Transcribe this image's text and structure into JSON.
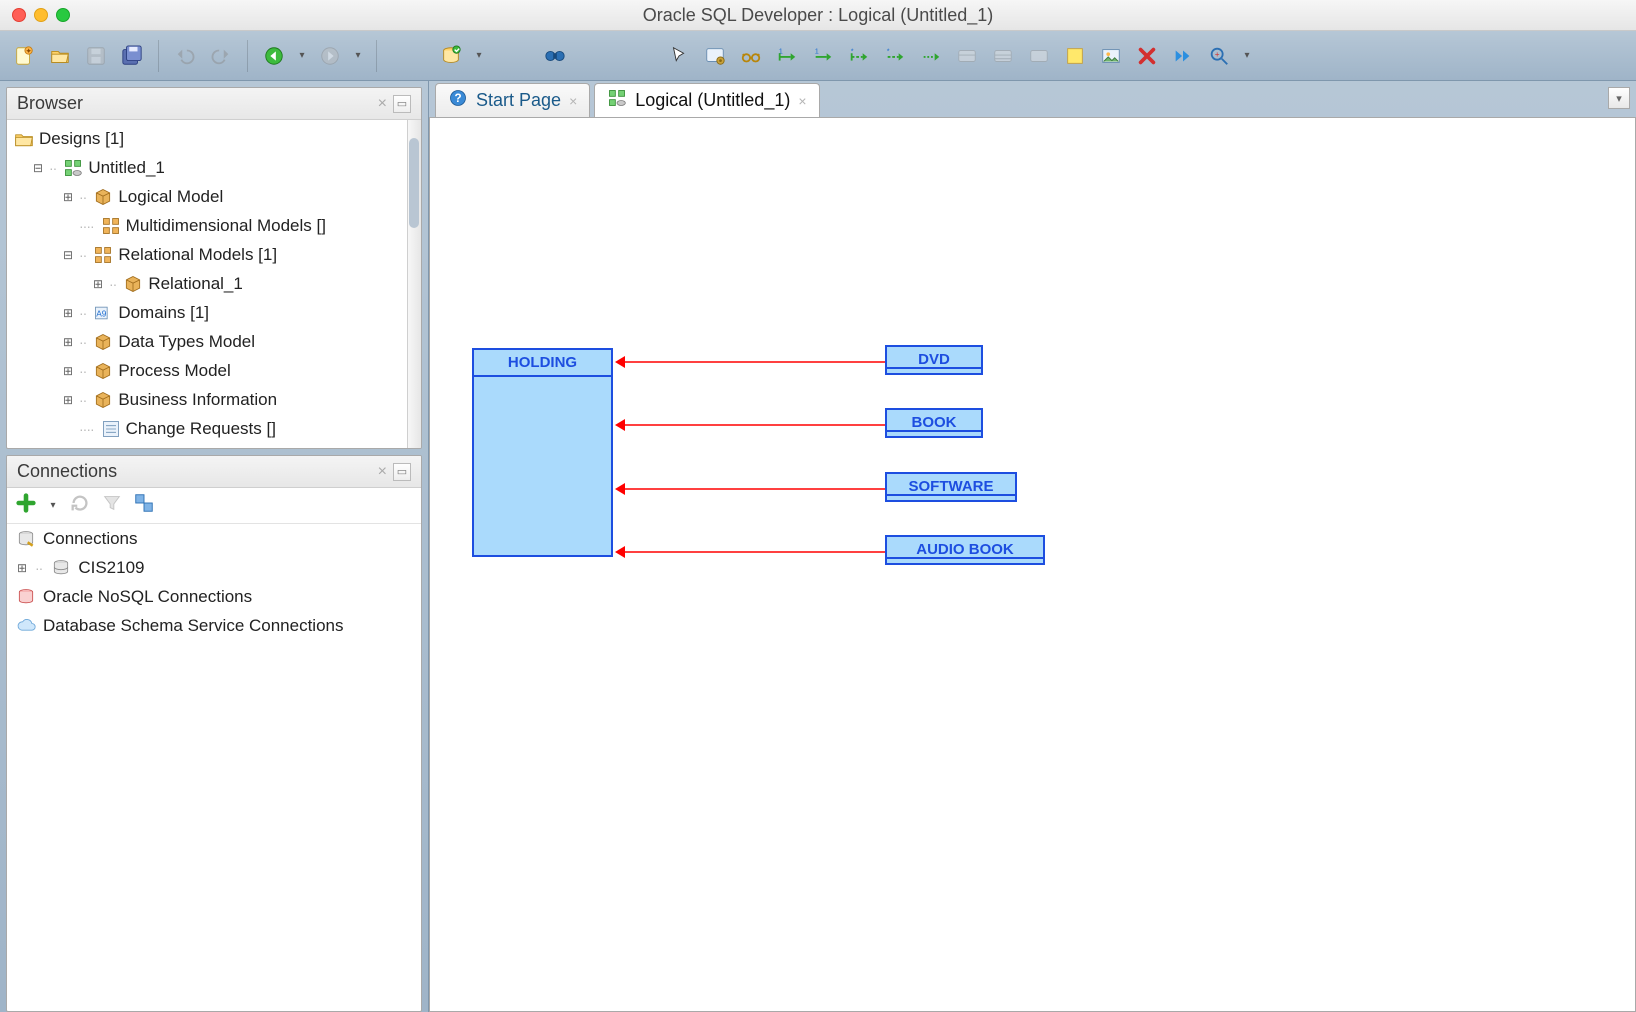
{
  "window": {
    "title": "Oracle SQL Developer : Logical (Untitled_1)"
  },
  "panels": {
    "browser": {
      "title": "Browser"
    },
    "connections": {
      "title": "Connections"
    }
  },
  "browser_tree": {
    "root": "Designs [1]",
    "design": "Untitled_1",
    "nodes": {
      "logical": "Logical Model",
      "multidim": "Multidimensional Models []",
      "relational": "Relational Models [1]",
      "relational_child": "Relational_1",
      "domains": "Domains [1]",
      "datatypes": "Data Types Model",
      "process": "Process Model",
      "business": "Business Information",
      "change": "Change Requests []"
    }
  },
  "connections": {
    "root": "Connections",
    "items": {
      "cis": "CIS2109",
      "nosql": "Oracle NoSQL Connections",
      "schema": "Database Schema Service Connections"
    }
  },
  "tabs": {
    "start": "Start Page",
    "logical": "Logical (Untitled_1)"
  },
  "diagram": {
    "parent": "HOLDING",
    "child1": "DVD",
    "child2": "BOOK",
    "child3": "SOFTWARE",
    "child4": "AUDIO BOOK"
  }
}
